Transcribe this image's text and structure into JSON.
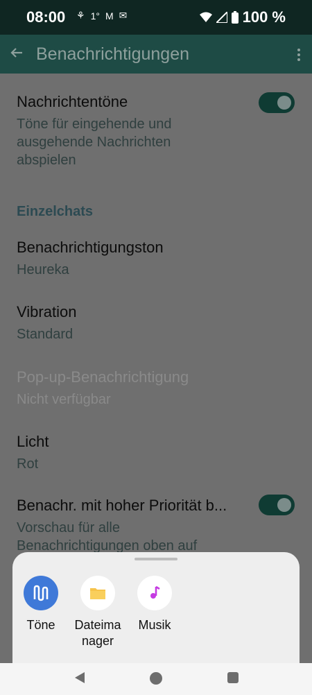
{
  "status_bar": {
    "time": "08:00",
    "icons_left": [
      "⚘",
      "1°",
      "M",
      "✉"
    ],
    "battery": "100 %",
    "icons_right": [
      "wifi-icon",
      "signal-icon",
      "battery-icon"
    ]
  },
  "app_bar": {
    "title": "Benachrichtigungen"
  },
  "settings": {
    "message_tones": {
      "title": "Nachrichtentöne",
      "subtitle": "Töne für eingehende und ausgehende Nachrichten abspielen",
      "enabled": true
    },
    "section_header": "Einzelchats",
    "notification_tone": {
      "title": "Benachrichtigungston",
      "value": "Heureka"
    },
    "vibration": {
      "title": "Vibration",
      "value": "Standard"
    },
    "popup": {
      "title": "Pop-up-Benachrichtigung",
      "value": "Nicht verfügbar"
    },
    "light": {
      "title": "Licht",
      "value": "Rot"
    },
    "high_priority": {
      "title": "Benachr. mit hoher Priorität b...",
      "subtitle": "Vorschau für alle Benachrichtigungen oben auf",
      "enabled": true
    }
  },
  "sheet": {
    "options": [
      {
        "label": "Töne",
        "icon": "tones-icon",
        "color": "#3f79d8"
      },
      {
        "label": "Dateima nager",
        "icon": "folder-icon",
        "color": "#f6c34a"
      },
      {
        "label": "Musik",
        "icon": "music-note-icon",
        "color": "#c53be2"
      }
    ]
  }
}
